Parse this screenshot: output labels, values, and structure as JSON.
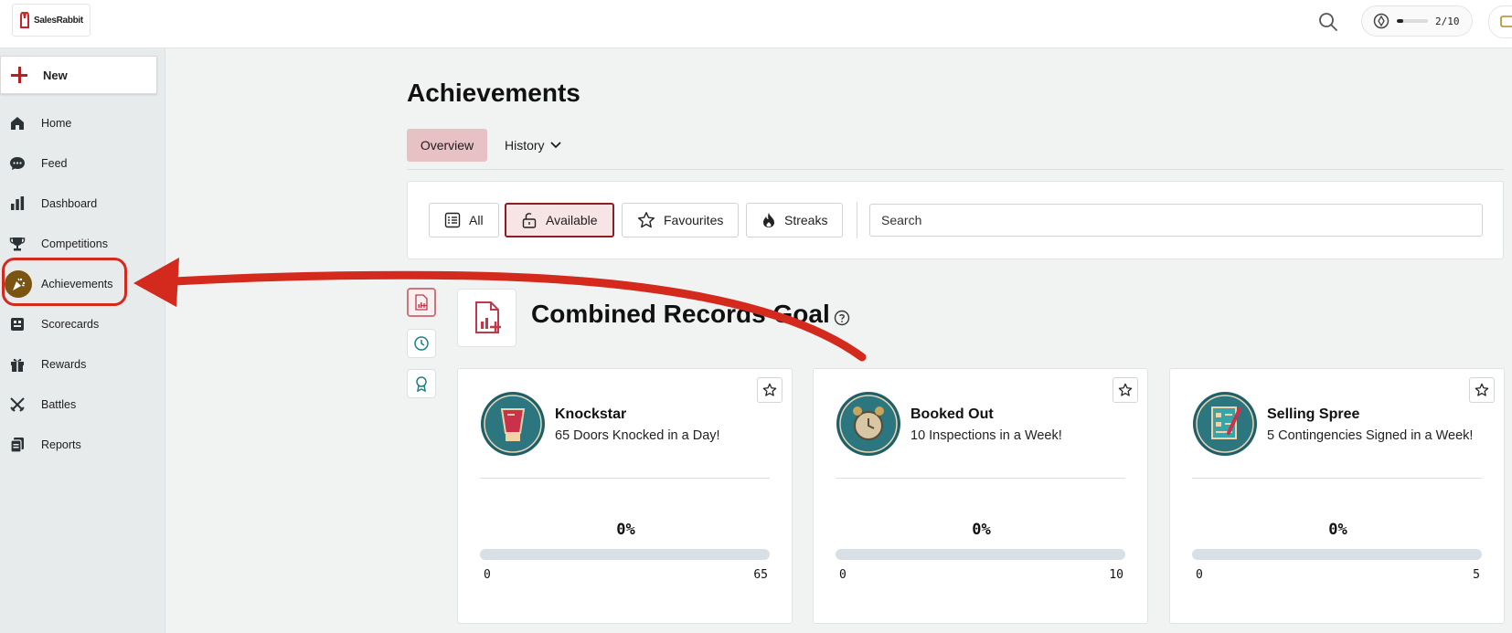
{
  "brand": {
    "logo_text": "SalesRabbit",
    "accent": "#b41f24"
  },
  "topbar": {
    "progress": {
      "text": "2/10",
      "fraction": 0.2
    }
  },
  "sidebar": {
    "new_label": "New",
    "items": [
      {
        "label": "Home",
        "icon": "home-icon"
      },
      {
        "label": "Feed",
        "icon": "chat-bubble-icon"
      },
      {
        "label": "Dashboard",
        "icon": "bar-chart-icon"
      },
      {
        "label": "Competitions",
        "icon": "trophy-icon"
      },
      {
        "label": "Achievements",
        "icon": "party-popper-icon",
        "active": true
      },
      {
        "label": "Scorecards",
        "icon": "scorecard-icon"
      },
      {
        "label": "Rewards",
        "icon": "gift-icon"
      },
      {
        "label": "Battles",
        "icon": "crossed-swords-icon"
      },
      {
        "label": "Reports",
        "icon": "reports-icon"
      }
    ]
  },
  "main": {
    "title": "Achievements",
    "tabs": {
      "overview": "Overview",
      "history": "History"
    },
    "filters": [
      {
        "label": "All",
        "icon": "list-icon"
      },
      {
        "label": "Available",
        "icon": "unlock-icon",
        "selected": true
      },
      {
        "label": "Favourites",
        "icon": "star-icon"
      },
      {
        "label": "Streaks",
        "icon": "flame-icon"
      }
    ],
    "search_placeholder": "Search",
    "group_title": "Combined Records Goal",
    "cards": [
      {
        "name": "Knockstar",
        "description": "65 Doors Knocked in a Day!",
        "percent": "0%",
        "min": "0",
        "max": "65",
        "fraction": 0,
        "badge_icon": "boxing-glove-icon"
      },
      {
        "name": "Booked Out",
        "description": "10 Inspections in a Week!",
        "percent": "0%",
        "min": "0",
        "max": "10",
        "fraction": 0,
        "badge_icon": "alarm-clock-icon"
      },
      {
        "name": "Selling Spree",
        "description": "5 Contingencies Signed in a Week!",
        "percent": "0%",
        "min": "0",
        "max": "5",
        "fraction": 0,
        "badge_icon": "signed-checklist-icon"
      }
    ]
  },
  "colors": {
    "annotation": "#d42a1d",
    "selected_tab": "#e7c1c4",
    "badge_teal": "#1f5f68"
  }
}
